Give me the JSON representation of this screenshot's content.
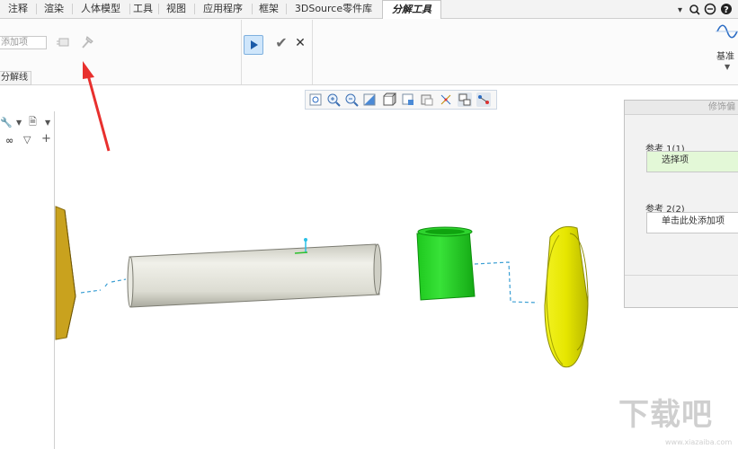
{
  "menu": {
    "tabs": [
      {
        "label": "注释"
      },
      {
        "label": "渲染"
      },
      {
        "label": "人体模型"
      },
      {
        "label": "工具"
      },
      {
        "label": "视图"
      },
      {
        "label": "应用程序"
      },
      {
        "label": "框架"
      },
      {
        "label": "3DSource零件库"
      },
      {
        "label": "分解工具"
      }
    ],
    "active_tab": "分解工具"
  },
  "ribbon": {
    "collector_placeholder": "添加项",
    "group_label": "分解线",
    "baseline_label": "基准"
  },
  "dialog": {
    "title": "修饰偏",
    "ref1_label": "参考 1(1)",
    "ref1_value": "选择项",
    "ref2_label": "参考 2(2)",
    "ref2_value": "单击此处添加项"
  },
  "watermark": {
    "text": "下载吧",
    "url": "www.xiazaiba.com"
  },
  "colors": {
    "accent_blue": "#1a5aa8",
    "selection_green": "#e3f8d7",
    "part_green": "#1ed31e",
    "part_yellow": "#e6e600",
    "part_gold": "#c9a21e",
    "cylinder_gray": "#dcdcd2",
    "arrow_red": "#e8302e"
  }
}
